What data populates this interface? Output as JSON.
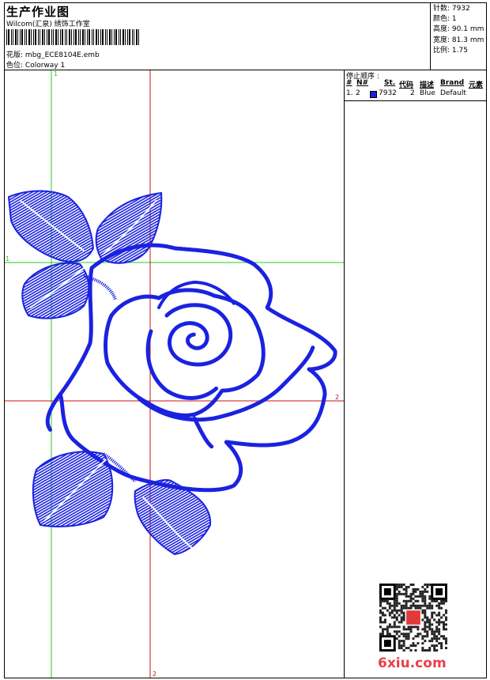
{
  "header": {
    "title": "生产作业图",
    "company": "Wilcom(汇泉) 绣饰工作室",
    "file_label": "花版:",
    "file_name": "mbg_ECE8104E.emb",
    "colorway_label": "色位:",
    "colorway": "Colorway 1"
  },
  "stats": [
    {
      "label": "针数:",
      "value": "7932"
    },
    {
      "label": "颜色:",
      "value": "1"
    },
    {
      "label": "高度:",
      "value": "90.1 mm"
    },
    {
      "label": "宽度:",
      "value": "81.3 mm"
    },
    {
      "label": "比例:",
      "value": "1.75"
    }
  ],
  "stop_sequence": {
    "title": "停止顺序 :",
    "columns": [
      "#",
      "N#",
      "St.",
      "代码",
      "描述",
      "Brand",
      "元素"
    ],
    "rows": [
      {
        "index": "1.",
        "needle": "2",
        "stitches": "7932",
        "code": "2",
        "description": "Blue",
        "brand": "Default",
        "swatch": "#1a22e0"
      }
    ]
  },
  "guides": {
    "green_label": "1",
    "red_label": "2"
  },
  "design": {
    "thread_color": "#1a22e0",
    "green_color": "#22cc22",
    "red_color": "#cc1111"
  },
  "watermark": {
    "text": "6xiu.com",
    "stamp_text": "汇泉"
  }
}
